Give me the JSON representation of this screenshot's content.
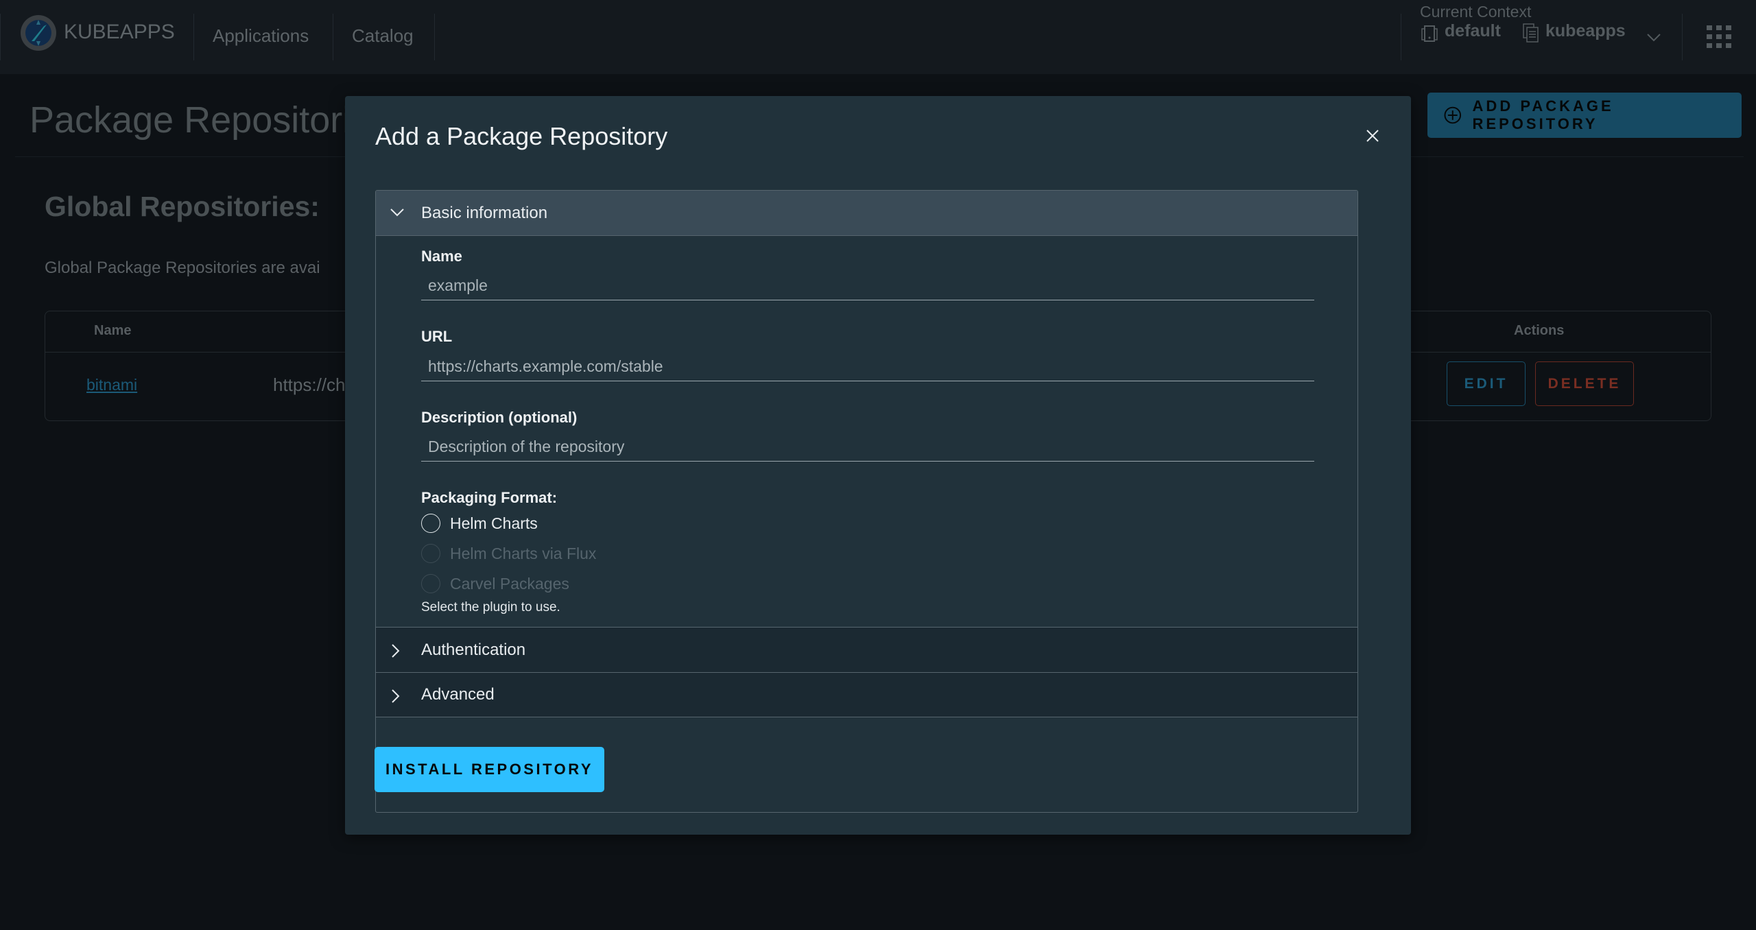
{
  "header": {
    "brand": "KUBEAPPS",
    "nav": [
      "Applications",
      "Catalog"
    ],
    "context_label": "Current Context",
    "cluster": "default",
    "namespace": "kubeapps"
  },
  "page": {
    "title": "Package Repositories",
    "add_button": "ADD PACKAGE REPOSITORY",
    "section_title": "Global Repositories:",
    "section_desc": "Global Package Repositories are avai",
    "table": {
      "columns": [
        "Name",
        "Actions"
      ],
      "rows": [
        {
          "name": "bitnami",
          "url": "https://ch",
          "edit": "EDIT",
          "delete": "DELETE"
        }
      ]
    }
  },
  "modal": {
    "title": "Add a Package Repository",
    "sections": {
      "basic": "Basic information",
      "auth": "Authentication",
      "advanced": "Advanced"
    },
    "fields": {
      "name_label": "Name",
      "name_placeholder": "example",
      "url_label": "URL",
      "url_placeholder": "https://charts.example.com/stable",
      "desc_label": "Description (optional)",
      "desc_placeholder": "Description of the repository"
    },
    "format": {
      "label": "Packaging Format:",
      "options": [
        {
          "label": "Helm Charts",
          "disabled": false
        },
        {
          "label": "Helm Charts via Flux",
          "disabled": true
        },
        {
          "label": "Carvel Packages",
          "disabled": true
        }
      ],
      "hint": "Select the plugin to use."
    },
    "install_button": "INSTALL REPOSITORY"
  },
  "colors": {
    "accent": "#2ebfff",
    "modal_bg": "#21323b",
    "danger": "#c0392b"
  }
}
